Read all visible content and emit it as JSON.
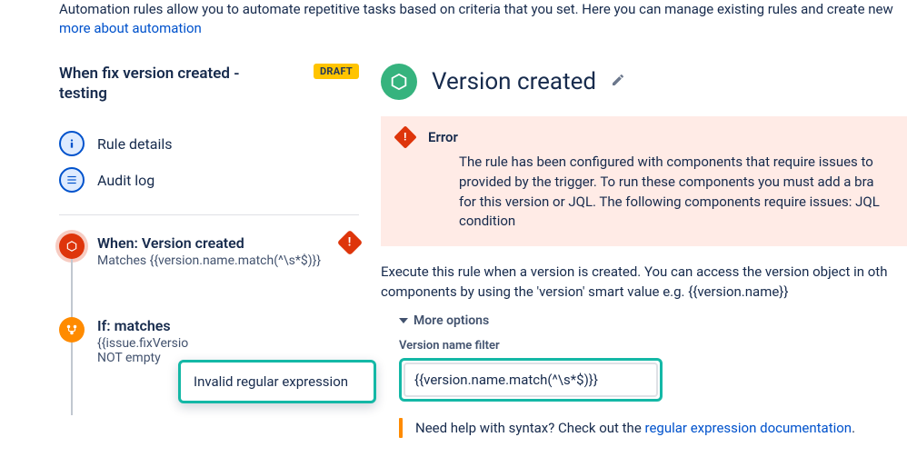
{
  "intro": {
    "line1": "Automation rules allow you to automate repetitive tasks based on criteria that you set. Here you can manage existing rules and create new",
    "link": "more about automation"
  },
  "rule": {
    "title": "When fix version created - testing",
    "status_badge": "DRAFT"
  },
  "sidenav": {
    "details": "Rule details",
    "audit": "Audit log"
  },
  "steps": {
    "trigger_title": "When: Version created",
    "trigger_sub": "Matches {{version.name.match(^\\s*$)}}",
    "cond_title": "If: matches",
    "cond_sub1": "{{issue.fixVersio",
    "cond_sub2": "NOT empty"
  },
  "tooltip": {
    "text": "Invalid regular expression"
  },
  "panel": {
    "title": "Version created",
    "error_title": "Error",
    "error_body": "The rule has been configured with components that require issues to provided by the trigger. To run these components you must add a bra for this version or JQL. The following components require issues: JQL condition",
    "exec_desc": "Execute this rule when a version is created. You can access the version object in oth components by using the 'version' smart value e.g. {{version.name}}",
    "more_options": "More options",
    "filter_label": "Version name filter",
    "filter_value": "{{version.name.match(^\\s*$)}}",
    "help_prefix": "Need help with syntax? Check out the ",
    "help_link": "regular expression documentation",
    "help_suffix": "."
  }
}
